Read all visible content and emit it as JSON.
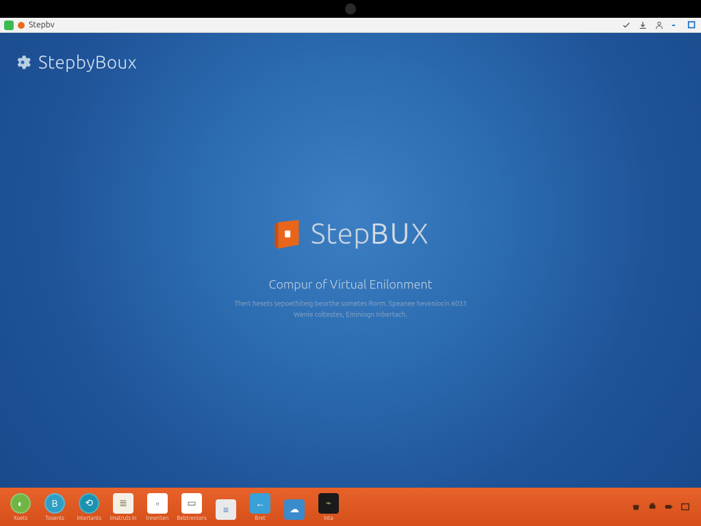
{
  "tab": {
    "title": "Stepbv"
  },
  "app_title": "StepbyBoux",
  "brand": {
    "part1": "Step",
    "part2": "BU",
    "part3": "X"
  },
  "subtitle": "Compur of Virtual Enilonment",
  "desc_line1": "Thert hesets sepoethiteig beorthe sometes Rorm. Speanee heveniocin 6033",
  "desc_line2": "Wenie coltestes, Eminiogn Inbertach.",
  "taskbar": {
    "items": [
      {
        "label": "Xoets",
        "bg": "#6fb544",
        "glyph": "◐"
      },
      {
        "label": "Tosents",
        "bg": "#2e9ec4",
        "glyph": "B"
      },
      {
        "label": "Intertants",
        "bg": "#1a92b0",
        "glyph": "⟲"
      },
      {
        "label": "Imatruts In",
        "bg": "#f5f0e6",
        "glyph": "≣",
        "sq": true
      },
      {
        "label": "Inneriten",
        "bg": "#ffffff",
        "glyph": "▫",
        "sq": true,
        "accent": "#e8622a"
      },
      {
        "label": "Bebtrenters",
        "bg": "#ffffff",
        "glyph": "▭",
        "sq": true
      },
      {
        "label": "",
        "bg": "#eaeaea",
        "glyph": "≡",
        "sq": true
      },
      {
        "label": "Bret",
        "bg": "#3aa0d8",
        "glyph": "←",
        "sq": true
      },
      {
        "label": "",
        "bg": "#3a8bcc",
        "glyph": "☁",
        "sq": true
      },
      {
        "label": "Inta",
        "bg": "#1a1a1a",
        "glyph": "⌁",
        "sq": true,
        "dark": true
      }
    ]
  }
}
